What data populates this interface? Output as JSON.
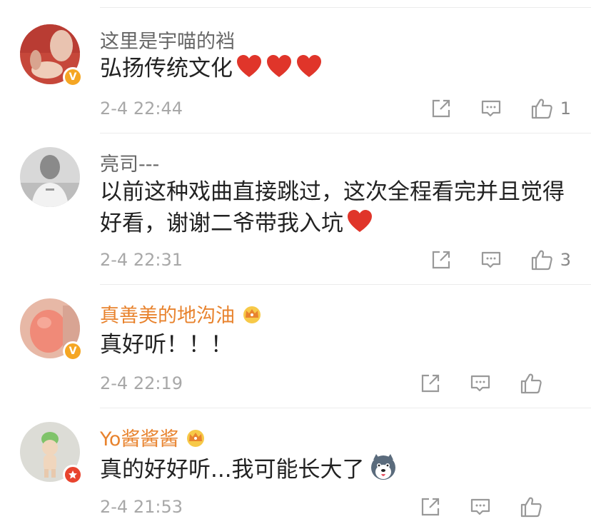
{
  "comments": [
    {
      "username": "这里是宇喵的裆",
      "text": "弘扬传统文化",
      "time": "2-4 22:44",
      "likes": "1",
      "badge": "V",
      "name_color": "#666666"
    },
    {
      "username": "亮司---",
      "text": "以前这种戏曲直接跳过，这次全程看完并且觉得好看，谢谢二爷带我入坑",
      "time": "2-4 22:31",
      "likes": "3",
      "name_color": "#666666"
    },
    {
      "username": "真善美的地沟油",
      "text": "真好听！！！",
      "time": "2-4 22:19",
      "likes": "",
      "badge": "V",
      "name_color": "#e8832e"
    },
    {
      "username": "Yo酱酱酱",
      "text": "真的好好听...我可能长大了",
      "time": "2-4 21:53",
      "likes": "",
      "name_color": "#e8832e"
    }
  ],
  "icons": {
    "share": "share-icon",
    "comment": "comment-icon",
    "like": "thumbs-up-icon",
    "heart": "red-heart-icon",
    "crown": "crown-icon",
    "husky": "husky-emoji-icon"
  },
  "colors": {
    "heart": "#e0352a",
    "vip_badge": "#f5a623",
    "divider": "#ececec",
    "gold_name": "#e8832e"
  }
}
